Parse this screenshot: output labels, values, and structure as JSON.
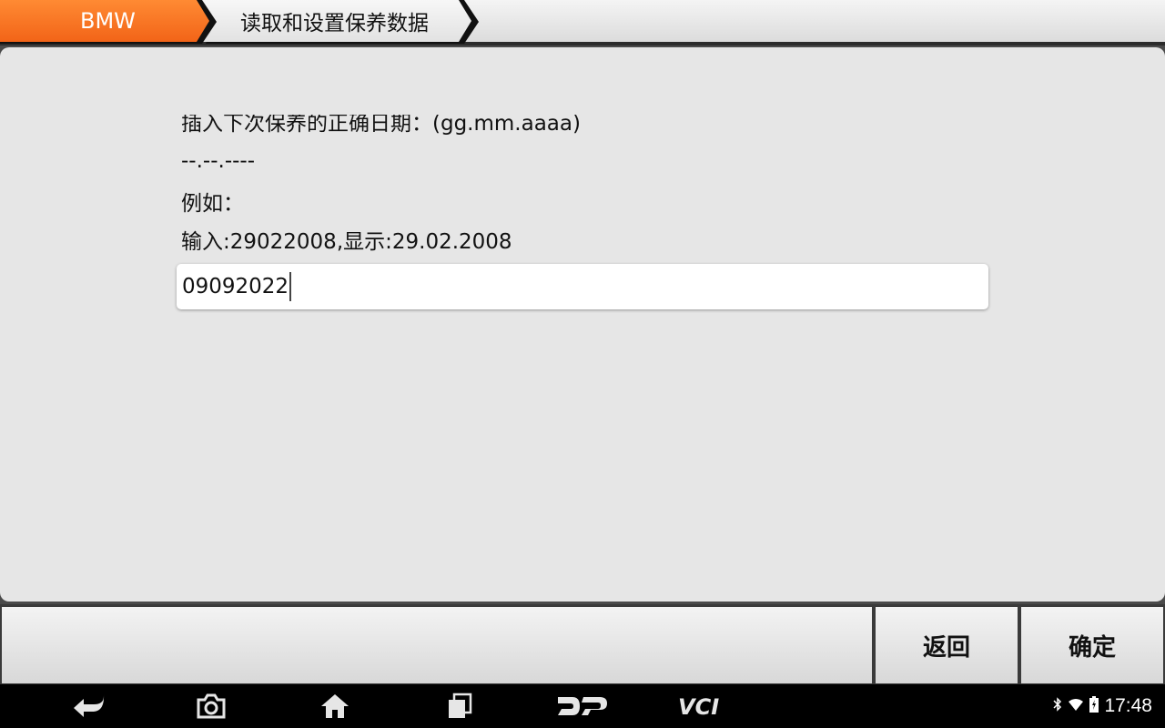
{
  "header": {
    "brand": "BMW",
    "page_title": "读取和设置保养数据"
  },
  "content": {
    "line1": "插入下次保养的正确日期：(gg.mm.aaaa)",
    "line2": "--.--.----",
    "line3": "例如：",
    "line4": "输入:29022008,显示:29.02.2008",
    "input_value": "09092022"
  },
  "actions": {
    "back_label": "返回",
    "ok_label": "确定"
  },
  "navbar": {
    "icons": [
      "back-icon",
      "camera-icon",
      "home-icon",
      "recent-apps-icon",
      "dp-icon",
      "vci-icon"
    ],
    "status_icons": [
      "bluetooth-icon",
      "wifi-icon",
      "battery-icon"
    ],
    "time": "17:48"
  },
  "colors": {
    "brand_orange": "#f26418",
    "panel_bg": "#e6e6e6"
  }
}
